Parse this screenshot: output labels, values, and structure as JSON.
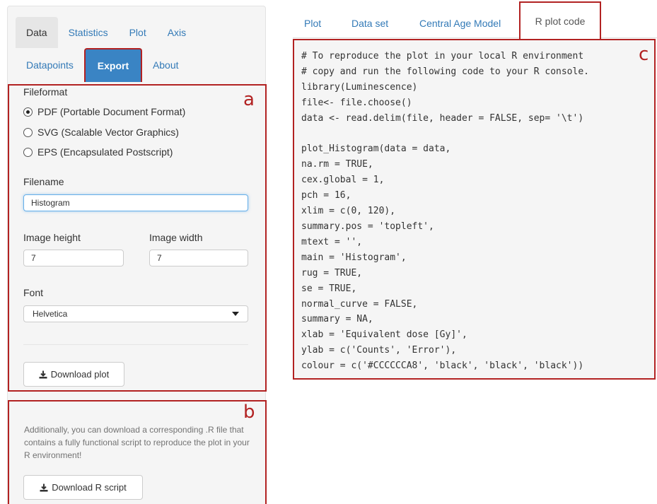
{
  "left_tabs": {
    "row1": [
      "Data",
      "Statistics",
      "Plot",
      "Axis"
    ],
    "row2": [
      "Datapoints",
      "Export",
      "About"
    ]
  },
  "export_form": {
    "fileformat_label": "Fileformat",
    "formats": [
      {
        "label": "PDF (Portable Document Format)",
        "selected": true
      },
      {
        "label": "SVG (Scalable Vector Graphics)",
        "selected": false
      },
      {
        "label": "EPS (Encapsulated Postscript)",
        "selected": false
      }
    ],
    "filename_label": "Filename",
    "filename_value": "Histogram",
    "height_label": "Image height",
    "height_value": "7",
    "width_label": "Image width",
    "width_value": "7",
    "font_label": "Font",
    "font_value": "Helvetica",
    "download_plot_label": "Download plot"
  },
  "script_section": {
    "help_text": "Additionally, you can download a corresponding .R file that contains a fully functional script to reproduce the plot in your R environment!",
    "download_script_label": "Download R script"
  },
  "box_letters": {
    "a": "a",
    "b": "b",
    "c": "c"
  },
  "right_tabs": [
    "Plot",
    "Data set",
    "Central Age Model",
    "R plot code"
  ],
  "active_right_tab": "R plot code",
  "code_lines": [
    "# To reproduce the plot in your local R environment",
    "# copy and run the following code to your R console.",
    "library(Luminescence)",
    "file<- file.choose()",
    "data <- read.delim(file, header = FALSE, sep= '\\t')",
    "",
    "plot_Histogram(data = data,",
    "na.rm = TRUE,",
    "cex.global = 1,",
    "pch = 16,",
    "xlim = c(0, 120),",
    "summary.pos = 'topleft',",
    "mtext = '',",
    "main = 'Histogram',",
    "rug = TRUE,",
    "se = TRUE,",
    "normal_curve = FALSE,",
    "summary = NA,",
    "xlab = 'Equivalent dose [Gy]',",
    "ylab = c('Counts', 'Error'),",
    "colour = c('#CCCCCCA8', 'black', 'black', 'black'))"
  ],
  "colors": {
    "accent": "#3a84c4",
    "highlight": "#b22222",
    "link": "#337ab7"
  }
}
